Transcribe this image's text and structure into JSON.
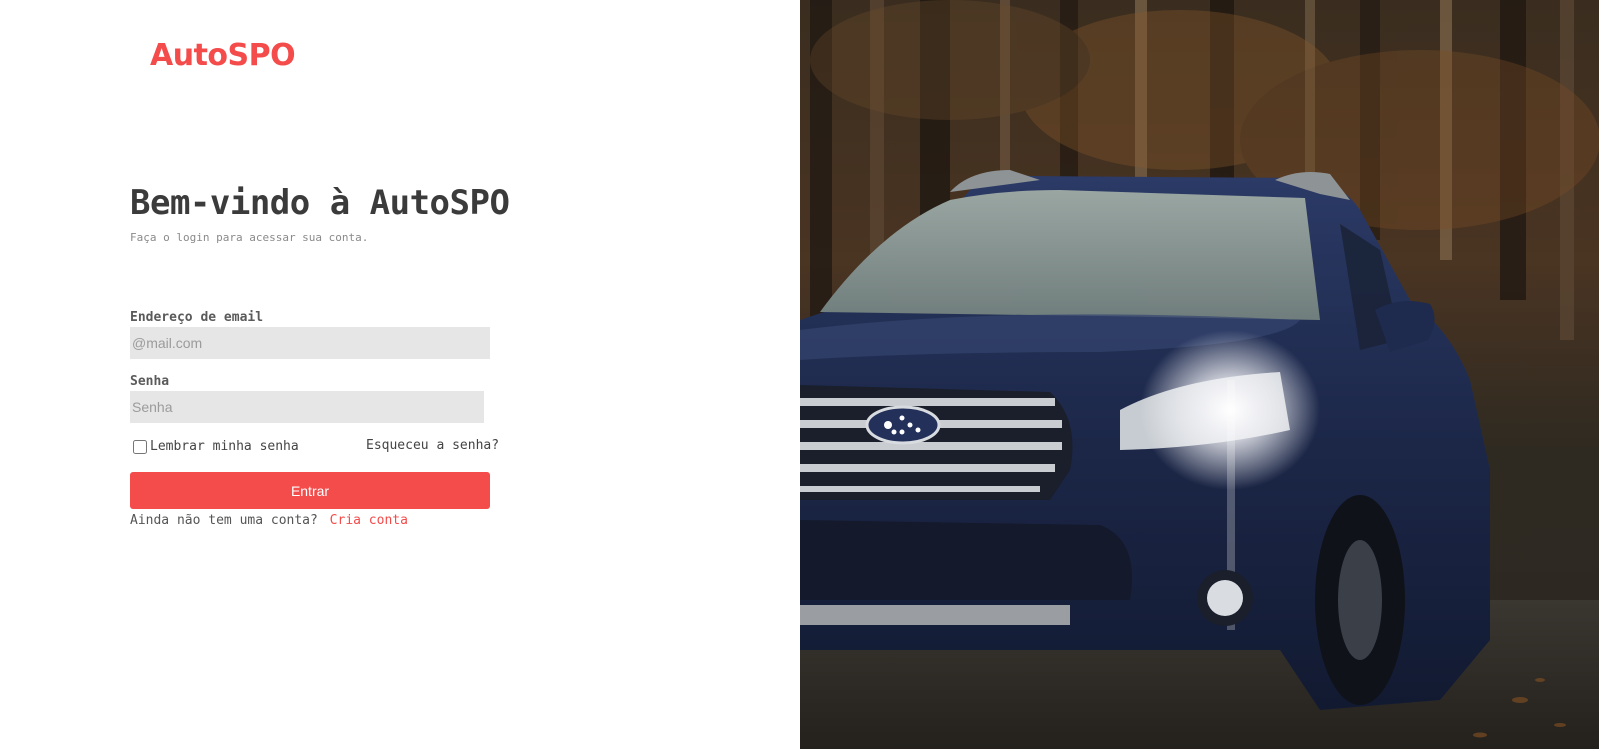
{
  "brand": {
    "name": "AutoSPO",
    "color": "#f44b4b"
  },
  "login": {
    "title": "Bem-vindo à AutoSPO",
    "subtitle": "Faça o login para acessar sua conta.",
    "email": {
      "label": "Endereço de email",
      "placeholder": "@mail.com",
      "value": ""
    },
    "password": {
      "label": "Senha",
      "placeholder": "Senha",
      "value": ""
    },
    "remember_label": "Lembrar minha senha",
    "remember_checked": false,
    "forgot_label": "Esqueceu a senha?",
    "submit_label": "Entrar",
    "signup_prompt": "Ainda não tem uma conta?",
    "signup_link": "Cria conta"
  },
  "hero": {
    "subject": "dark blue car with headlight on in an autumn forest"
  }
}
